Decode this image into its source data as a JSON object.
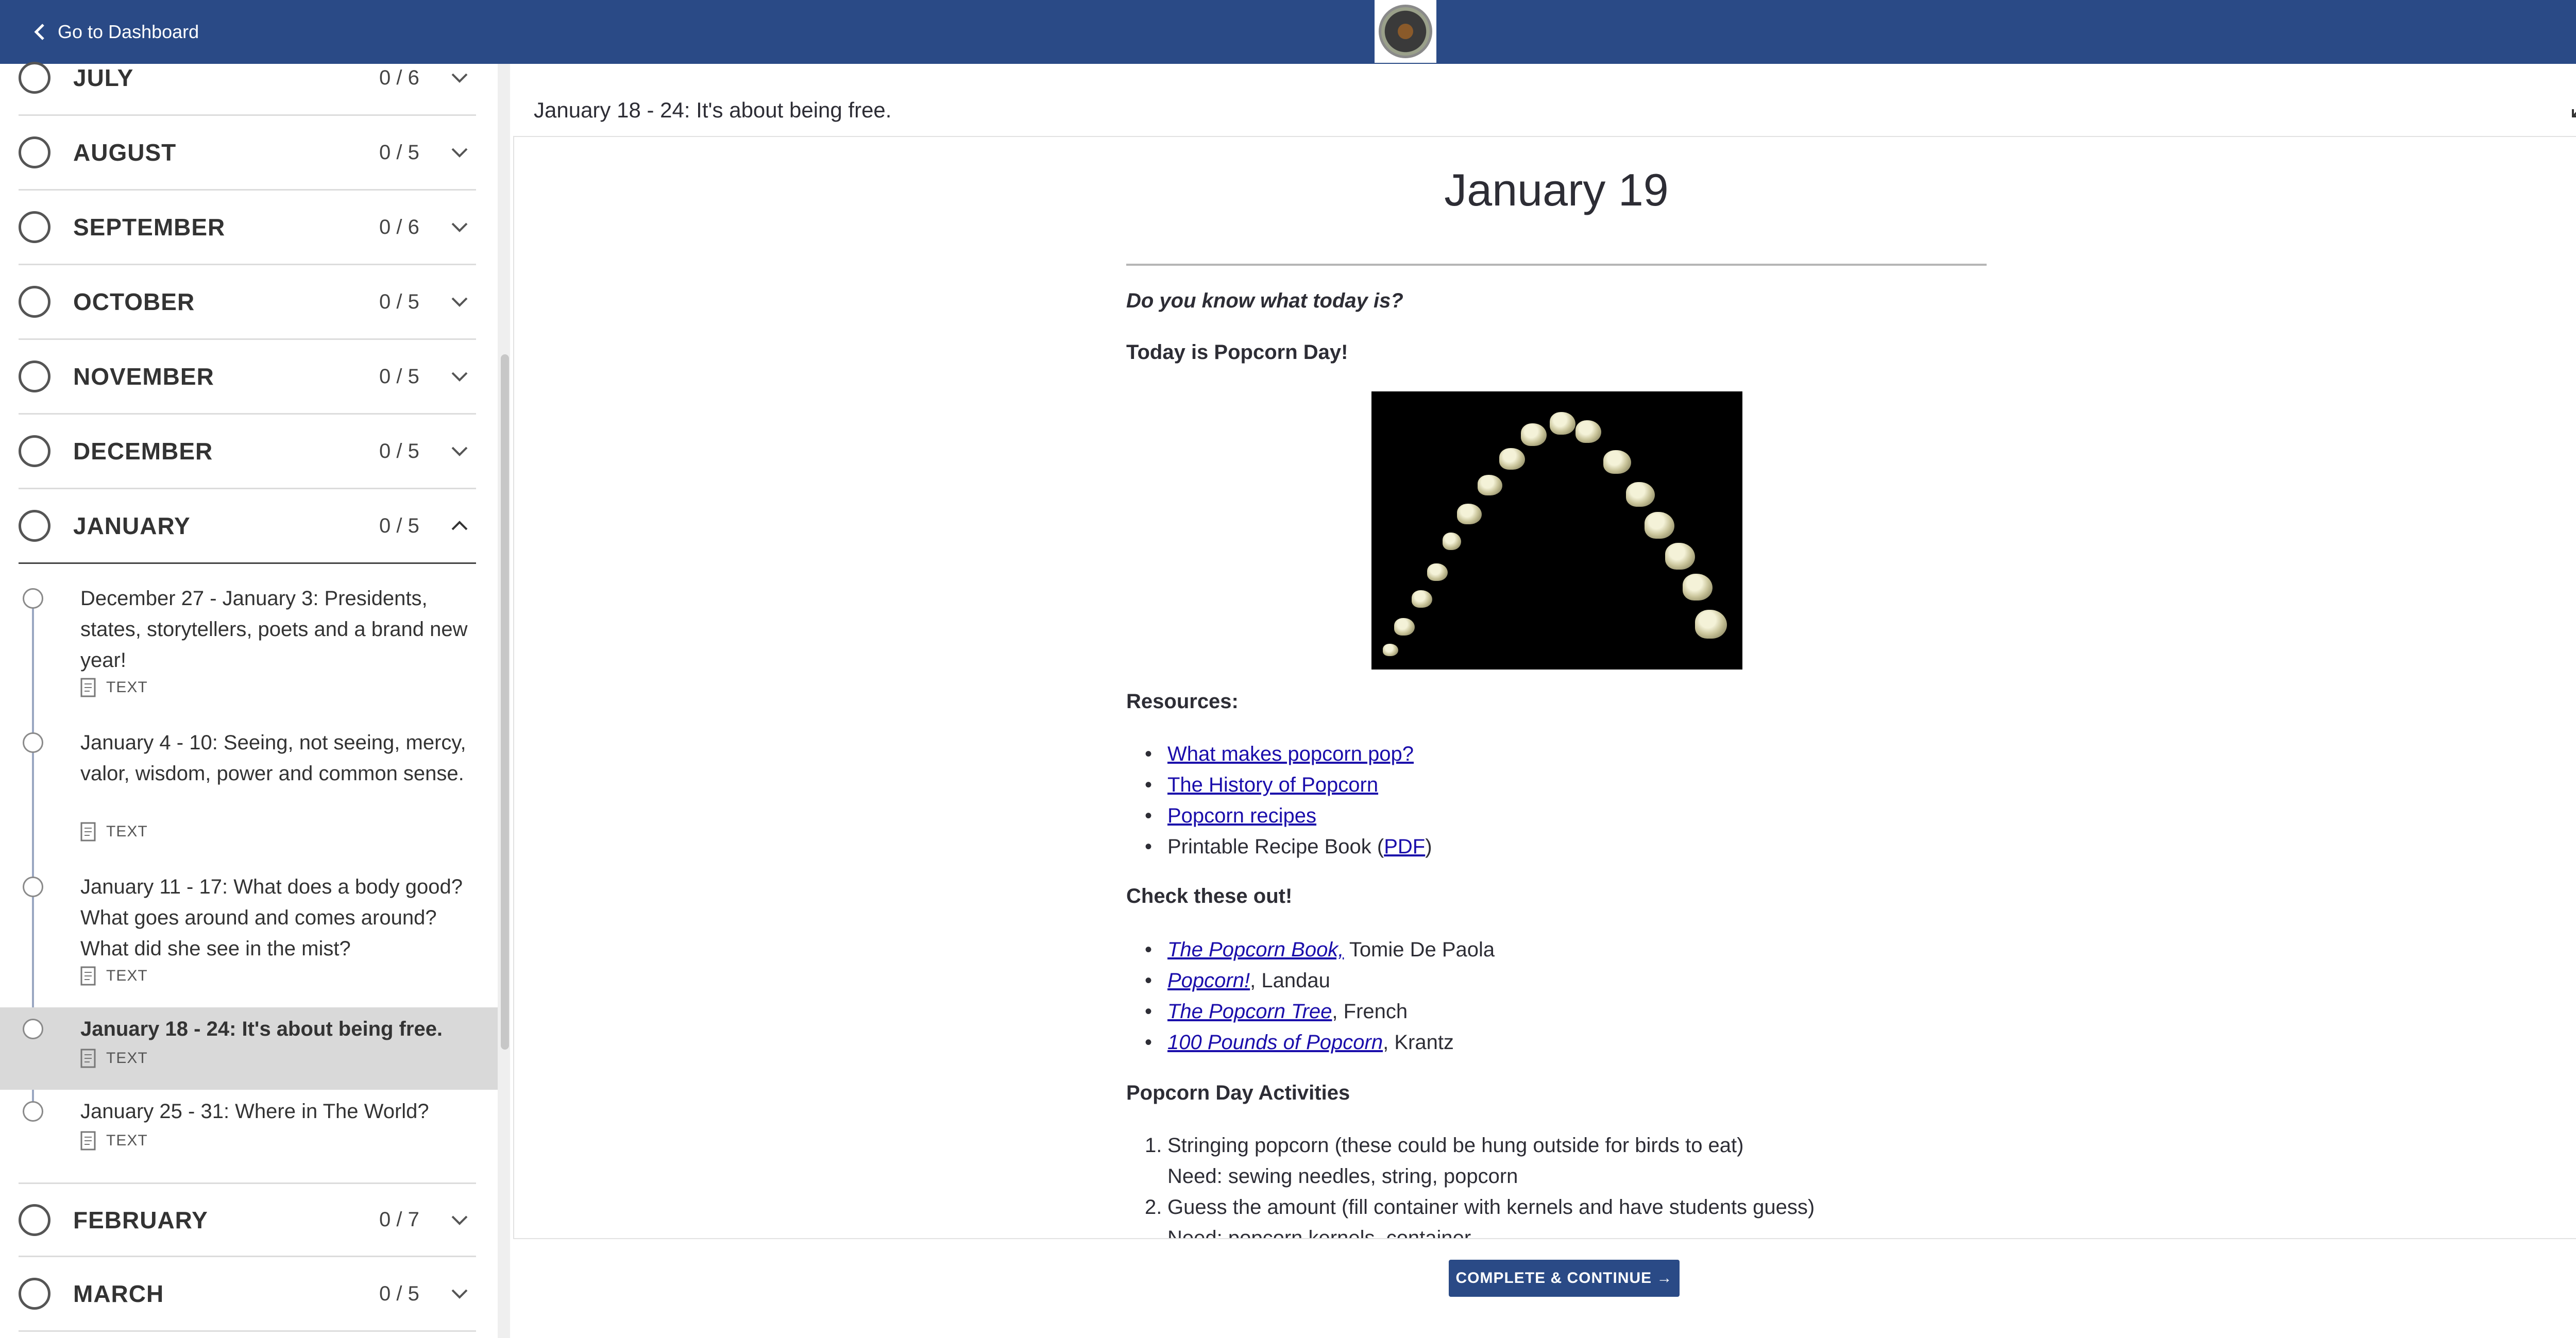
{
  "topbar": {
    "back_label": "Go to Dashboard"
  },
  "sidebar": {
    "months_top": [
      {
        "name": "JULY",
        "count": "0 / 6"
      },
      {
        "name": "AUGUST",
        "count": "0 / 5"
      },
      {
        "name": "SEPTEMBER",
        "count": "0 / 6"
      },
      {
        "name": "OCTOBER",
        "count": "0 / 5"
      },
      {
        "name": "NOVEMBER",
        "count": "0 / 5"
      },
      {
        "name": "DECEMBER",
        "count": "0 / 5"
      },
      {
        "name": "JANUARY",
        "count": "0 / 5"
      }
    ],
    "lessons": [
      {
        "title": "December 27 - January 3: Presidents, states, storytellers, poets and a brand new year!",
        "type": "TEXT"
      },
      {
        "title": "January 4 - 10: Seeing, not seeing, mercy, valor, wisdom, power and common sense.",
        "type": "TEXT"
      },
      {
        "title": "January 11 - 17: What does a body good? What goes around and comes around? What did she see in the mist?",
        "type": "TEXT"
      },
      {
        "title": "January 18 - 24: It's about being free.",
        "type": "TEXT"
      },
      {
        "title": "January 25 - 31: Where in The World?",
        "type": "TEXT"
      }
    ],
    "months_bottom": [
      {
        "name": "FEBRUARY",
        "count": "0 / 7"
      },
      {
        "name": "MARCH",
        "count": "0 / 5"
      }
    ]
  },
  "panel": {
    "title": "January 18 - 24: It's about being free."
  },
  "content": {
    "heading": "January 19",
    "question": "Do you know what today is?",
    "today": "Today is Popcorn Day!",
    "resources_label": "Resources:",
    "resources": {
      "link1": "What makes popcorn pop?",
      "link2": "The History of Popcorn",
      "link3": "Popcorn recipes",
      "recipe_prefix": "Printable Recipe Book (",
      "recipe_link": "PDF",
      "recipe_suffix": ")"
    },
    "check_label": "Check these out!",
    "books": [
      {
        "title": "The Popcorn Book,",
        "author": " Tomie De Paola"
      },
      {
        "title": "Popcorn!",
        "author": ", Landau"
      },
      {
        "title": "The Popcorn Tree",
        "author": ", French"
      },
      {
        "title": "100 Pounds of Popcorn",
        "author": ", Krantz"
      }
    ],
    "activities_label": "Popcorn Day Activities",
    "activities": [
      {
        "num": "1.",
        "line1": "Stringing popcorn (these could be hung outside for birds to eat)",
        "line2": "Need: sewing needles, string, popcorn"
      },
      {
        "num": "2.",
        "line1": "Guess the amount (fill container with kernels and have students guess)",
        "line2": "Need: popcorn kernels, container"
      }
    ]
  },
  "footer": {
    "cta_label": "COMPLETE & CONTINUE →"
  }
}
